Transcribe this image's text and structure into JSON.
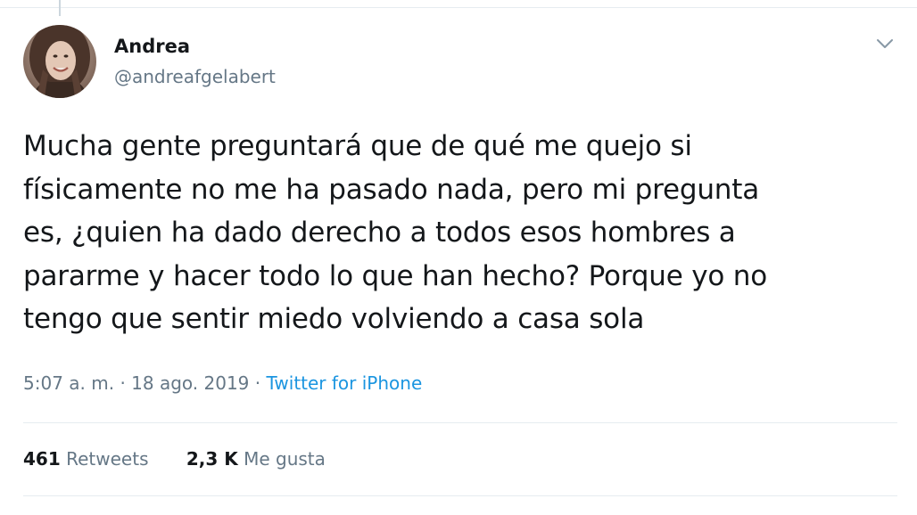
{
  "tweet": {
    "author_name": "Andrea",
    "author_handle": "@andreafgelabert",
    "text": "Mucha gente preguntará que de qué me quejo si\nfísicamente no me ha pasado nada, pero mi pregunta\nes, ¿quien ha dado derecho a todos esos hombres a\npararme y hacer todo lo que han hecho? Porque yo no\ntengo que sentir miedo volviendo a casa sola",
    "timestamp": "5:07 a. m. · 18 ago. 2019",
    "separator": " · ",
    "source": "Twitter for iPhone",
    "stats": {
      "retweets_count": "461",
      "retweets_label": "Retweets",
      "likes_count": "2,3 K",
      "likes_label": "Me gusta"
    },
    "menu_icon": "chevron-down-icon",
    "avatar_icon": "avatar"
  },
  "colors": {
    "text_primary": "#14171a",
    "text_secondary": "#657786",
    "link": "#1b95e0",
    "border": "#e6ecf0"
  }
}
